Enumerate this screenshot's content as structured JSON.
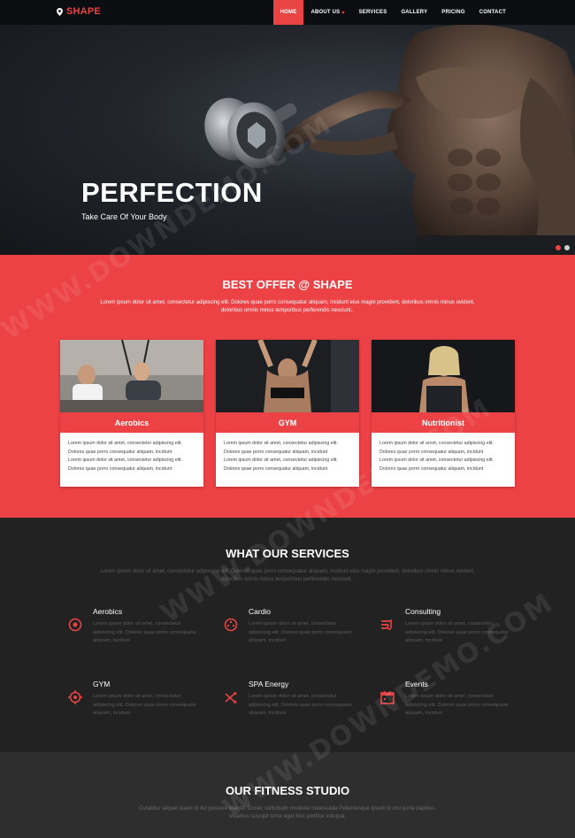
{
  "nav": {
    "logo": "SHAPE",
    "items": [
      {
        "label": "HOME",
        "active": true
      },
      {
        "label": "ABOUT US",
        "caret": true
      },
      {
        "label": "SERVICES"
      },
      {
        "label": "GALLERY"
      },
      {
        "label": "PRICING"
      },
      {
        "label": "CONTACT"
      }
    ]
  },
  "hero": {
    "title": "PERFECTION",
    "subtitle": "Take Care Of Your Body",
    "slides_total": 2,
    "active_slide": 1
  },
  "offer": {
    "title": "BEST OFFER @ SHAPE",
    "description": "Lorem ipsum dolor sit amet, consectetur adipiscing elit. Dolores quae porro consequatur aliquam, incidunt eius magni provident, doloribus omnis minus ovident, doloribus omnis minus temporibus perferendis nesciunt..",
    "cards": [
      {
        "title": "Aerobics",
        "lines": [
          "Lorem ipsum dolor sit amet, consectetur adipiscing elit.",
          "Dolores quae porro consequatur aliquam, incidunt",
          "Lorem ipsum dolor sit amet, consectetur adipiscing elit.",
          "Dolores quae porro consequatur aliquam, incidunt"
        ]
      },
      {
        "title": "GYM",
        "lines": [
          "Lorem ipsum dolor sit amet, consectetur adipiscing elit.",
          "Dolores quae porro consequatur aliquam, incidunt",
          "Lorem ipsum dolor sit amet, consectetur adipiscing elit.",
          "Dolores quae porro consequatur aliquam, incidunt"
        ]
      },
      {
        "title": "Nutritionist",
        "lines": [
          "Lorem ipsum dolor sit amet, consectetur adipiscing elit.",
          "Dolores quae porro consequatur aliquam, incidunt",
          "Lorem ipsum dolor sit amet, consectetur adipiscing elit.",
          "Dolores quae porro consequatur aliquam, incidunt"
        ]
      }
    ]
  },
  "services": {
    "title": "WHAT OUR SERVICES",
    "description": "Lorem ipsum dolor sit amet, consectetur adipiscing elit. Dolores quae porro consequatur aliquam, incidunt eius magni provident, doloribus omnis minus ovident, doloribus omnis minus temporibus perferendis nesciunt..",
    "items": [
      {
        "title": "Aerobics",
        "text": "Lorem ipsum dolor sit amet, consectetur adipiscing elit. Dolores quae porro consequatur aliquam, incidunt",
        "icon": "target-icon"
      },
      {
        "title": "Cardio",
        "text": "Lorem ipsum dolor sit amet, consectetur adipiscing elit. Dolores quae porro consequatur aliquam, incidunt",
        "icon": "dial-icon"
      },
      {
        "title": "Consulting",
        "text": "Lorem ipsum dolor sit amet, consectetur adipiscing elit. Dolores quae porro consequatur aliquam, incidunt",
        "icon": "list-icon"
      },
      {
        "title": "GYM",
        "text": "Lorem ipsum dolor sit amet, consectetur adipiscing elit. Dolores quae porro consequatur aliquam, incidunt",
        "icon": "crosshair-icon"
      },
      {
        "title": "SPA Energy",
        "text": "Lorem ipsum dolor sit amet, consectetur adipiscing elit. Dolores quae porro consequatur aliquam, incidunt",
        "icon": "shuffle-icon"
      },
      {
        "title": "Events",
        "text": "Lorem ipsum dolor sit amet, consectetur adipiscing elit. Dolores quae porro consequatur aliquam, incidunt",
        "icon": "calendar-icon"
      }
    ]
  },
  "studio": {
    "title": "OUR FITNESS STUDIO",
    "description": "Curabitur aliquet quam id dui posuere blandit. Donec sollicitudin molestie malesuada Pellentesque ipsum id orci porta dapibus. Vivamus suscipit tortor eget felis porttitor volutpat."
  },
  "watermark": "WWW.DOWNDEMO.COM",
  "colors": {
    "accent": "#ec4145",
    "dark": "#222222",
    "nav": "#0b0d10"
  }
}
